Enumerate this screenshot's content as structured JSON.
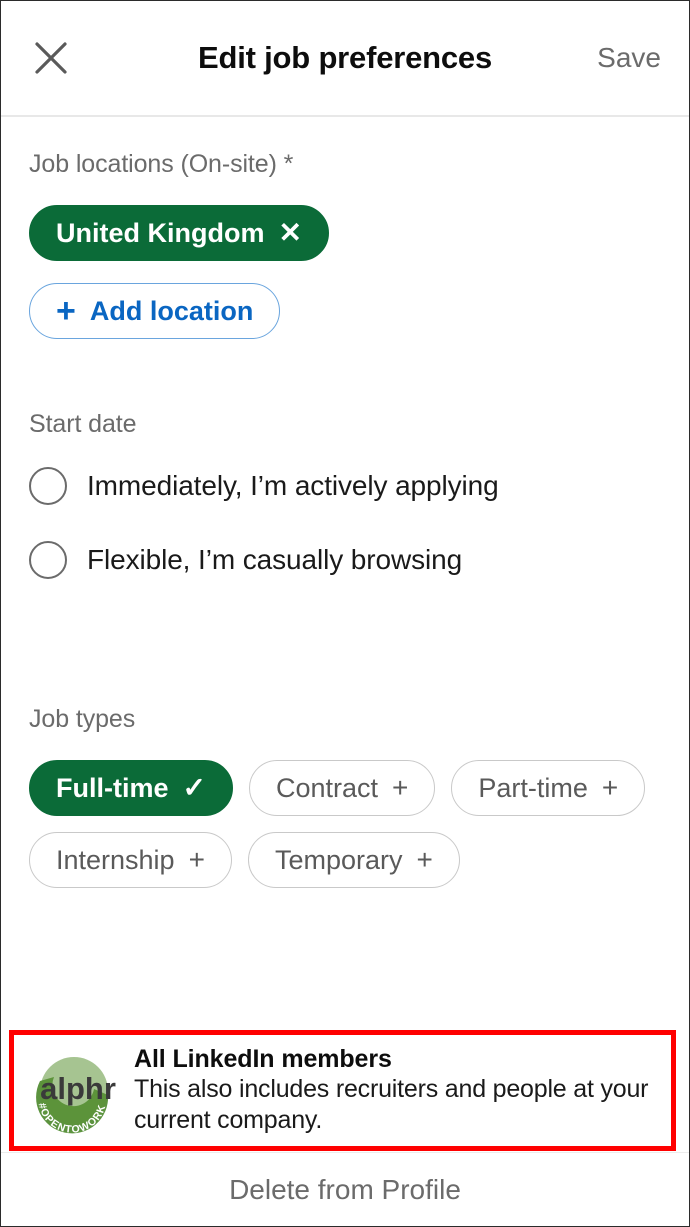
{
  "header": {
    "close_icon": "close-icon",
    "title": "Edit job preferences",
    "save_label": "Save"
  },
  "colors": {
    "accent_green": "#0b6b38",
    "accent_blue": "#0a66c2",
    "highlight_red": "#ff0000",
    "label_gray": "#6b6b6b"
  },
  "job_locations": {
    "label": "Job locations (On-site) *",
    "chips": [
      {
        "label": "United Kingdom",
        "glyph": "✕",
        "state": "selected"
      }
    ],
    "add_button": {
      "glyph": "+",
      "label": "Add location"
    }
  },
  "start_date": {
    "label": "Start date",
    "options": [
      {
        "label": "Immediately, I’m actively applying",
        "selected": false
      },
      {
        "label": "Flexible, I’m casually browsing",
        "selected": false
      }
    ]
  },
  "job_types": {
    "label": "Job types",
    "chips": [
      {
        "label": "Full-time",
        "glyph": "✓",
        "state": "selected"
      },
      {
        "label": "Contract",
        "glyph": "+",
        "state": "unselected"
      },
      {
        "label": "Part-time",
        "glyph": "+",
        "state": "unselected"
      },
      {
        "label": "Internship",
        "glyph": "+",
        "state": "unselected"
      },
      {
        "label": "Temporary",
        "glyph": "+",
        "state": "unselected"
      }
    ]
  },
  "highlight": {
    "watermark_text": "alphr",
    "watermark_badge": "#OPENTOWORK",
    "title": "All LinkedIn members",
    "body": "This also includes recruiters and people at your current company."
  },
  "footer": {
    "delete_label": "Delete from Profile"
  }
}
